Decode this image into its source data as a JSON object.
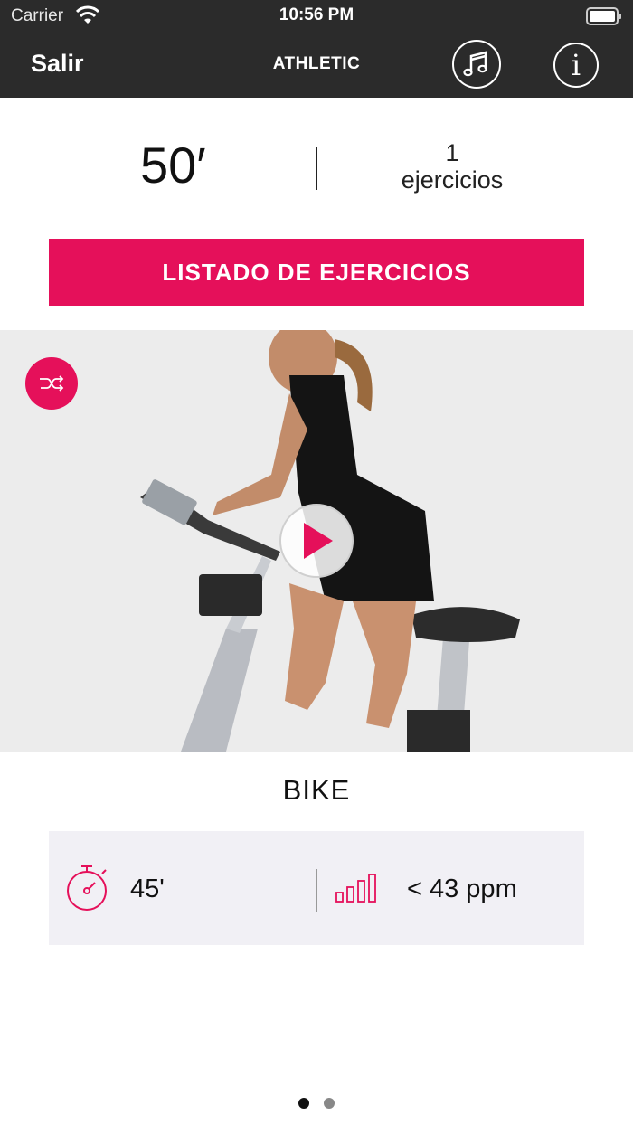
{
  "status_bar": {
    "carrier": "Carrier",
    "time": "10:56 PM"
  },
  "nav": {
    "exit_label": "Salir",
    "logo": "ATHLETIC",
    "info_label": "i"
  },
  "summary": {
    "duration": "50′",
    "exercise_count": "1",
    "exercise_unit": "ejercicios"
  },
  "list_button": {
    "label": "LISTADO DE EJERCICIOS"
  },
  "exercise": {
    "name": "BIKE",
    "duration": "45'",
    "pulse": "< 43 ppm"
  },
  "pager": {
    "pages": 2,
    "current": 1
  },
  "colors": {
    "accent": "#e5105a",
    "navbar": "#2b2b2b",
    "stats_bg": "#f1f0f5"
  }
}
